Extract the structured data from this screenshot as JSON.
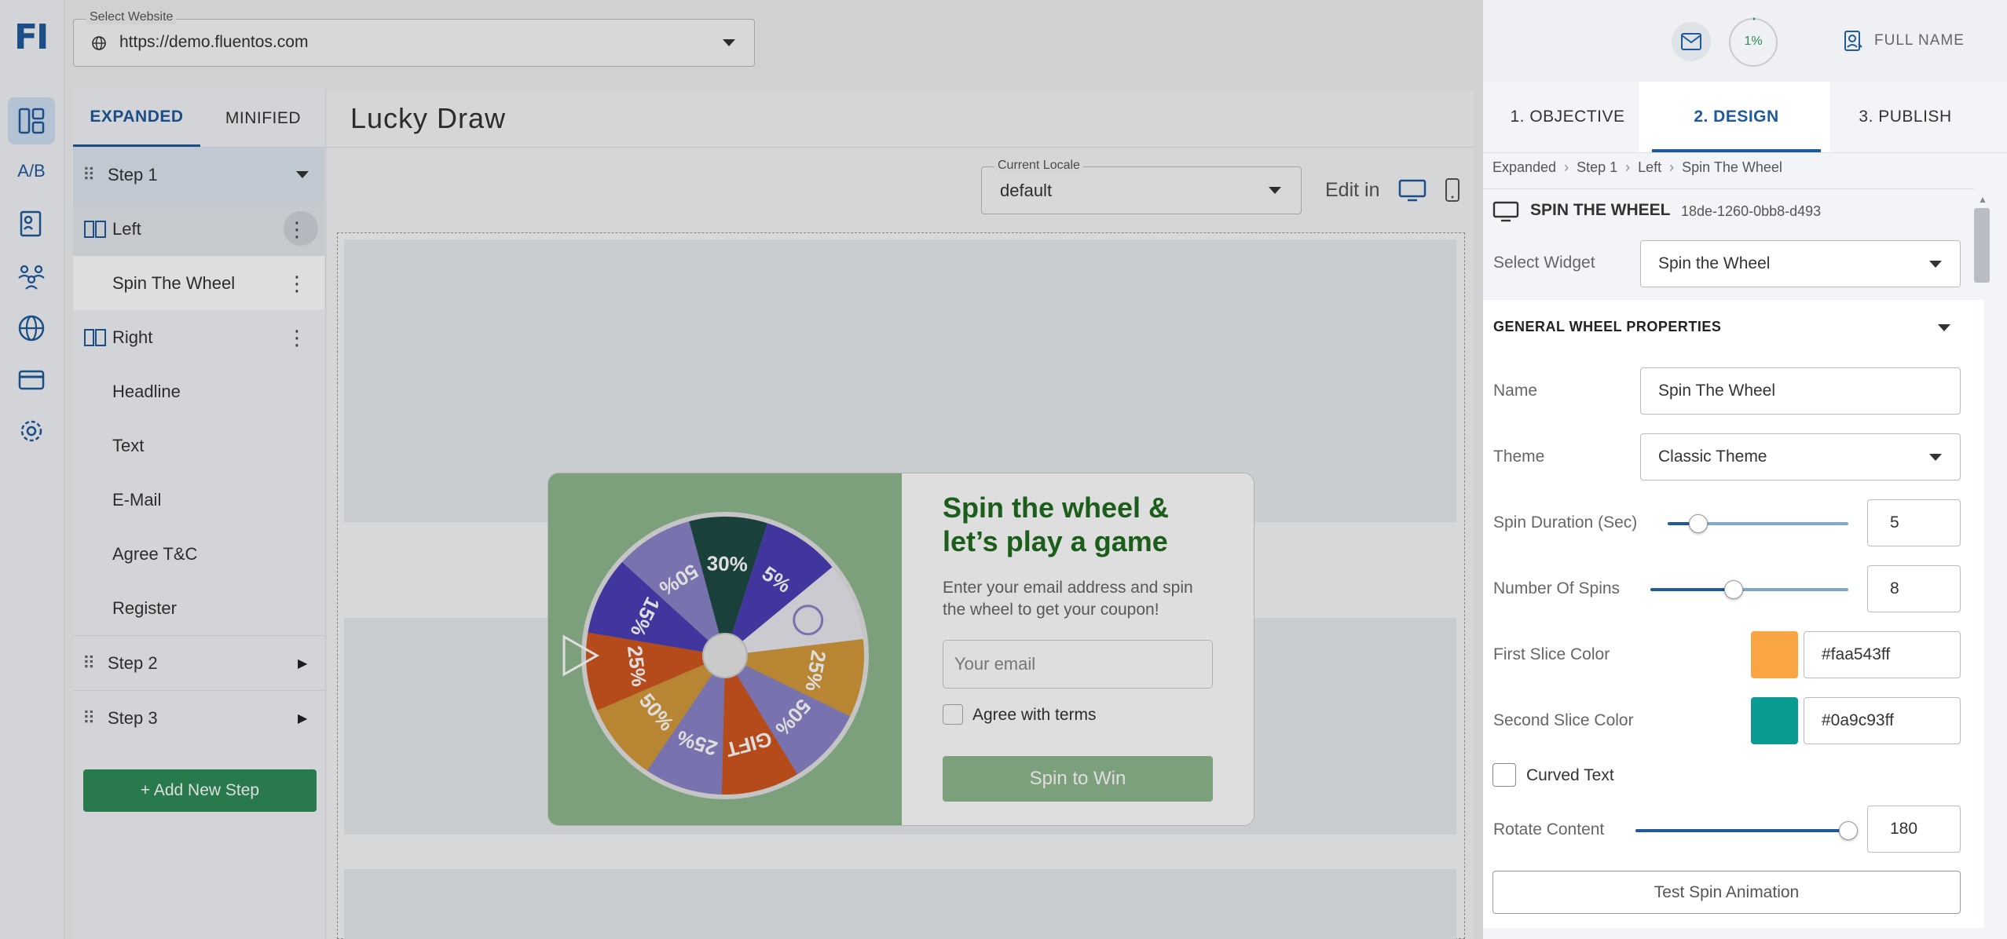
{
  "app": {
    "logo": "FI"
  },
  "rail": {
    "ab_label": "A/B"
  },
  "topbar": {
    "site_legend": "Select Website",
    "site_url": "https://demo.fluentos.com",
    "progress": "1%",
    "user_name": "FULL NAME"
  },
  "steps_panel": {
    "tabs": [
      "EXPANDED",
      "MINIFIED"
    ],
    "step1": "Step 1",
    "left": "Left",
    "spin": "Spin The Wheel",
    "right": "Right",
    "children": [
      "Headline",
      "Text",
      "E-Mail",
      "Agree T&C",
      "Register"
    ],
    "step2": "Step 2",
    "step3": "Step 3",
    "add_step": "+ Add New Step"
  },
  "canvas": {
    "title": "Lucky Draw",
    "locale_legend": "Current Locale",
    "locale_value": "default",
    "edit_in": "Edit in"
  },
  "popup": {
    "headline": "Spin the wheel & let’s play a game",
    "subtext": "Enter your email address and spin the wheel to get your coupon!",
    "email_placeholder": "Your email",
    "terms": "Agree with terms",
    "button": "Spin to Win",
    "close": "×",
    "slices": [
      "30%",
      "5%",
      "",
      "25%",
      "50%",
      "GIFT",
      "25%",
      "50%",
      "25%",
      "15%",
      "50%"
    ]
  },
  "right_panel": {
    "tabs": [
      "1. OBJECTIVE",
      "2. DESIGN",
      "3. PUBLISH"
    ],
    "breadcrumb": [
      "Expanded",
      "Step 1",
      "Left",
      "Spin The Wheel"
    ],
    "widget_title": "SPIN THE WHEEL",
    "widget_id": "18de-1260-0bb8-d493",
    "select_widget_label": "Select Widget",
    "select_widget_value": "Spin the Wheel",
    "section_title": "GENERAL WHEEL PROPERTIES",
    "name_label": "Name",
    "name_value": "Spin The Wheel",
    "theme_label": "Theme",
    "theme_value": "Classic Theme",
    "spin_duration_label": "Spin Duration (Sec)",
    "spin_duration_value": "5",
    "spin_duration_level": 0.17,
    "spins_label": "Number Of Spins",
    "spins_value": "8",
    "spins_level": 0.42,
    "first_color_label": "First Slice Color",
    "first_color_value": "#faa543ff",
    "first_color": "#faa543",
    "second_color_label": "Second Slice Color",
    "second_color_value": "#0a9c93ff",
    "second_color": "#0a9c93",
    "curved_label": "Curved Text",
    "rotate_label": "Rotate Content",
    "rotate_value": "180",
    "rotate_level": 1.0,
    "test_button": "Test Spin Animation"
  },
  "colors": {
    "brand": "#1f5a9a",
    "add_step": "#2e8b57",
    "popup_bg": "#8fb78f",
    "popup_heading": "#1f6b1f"
  }
}
